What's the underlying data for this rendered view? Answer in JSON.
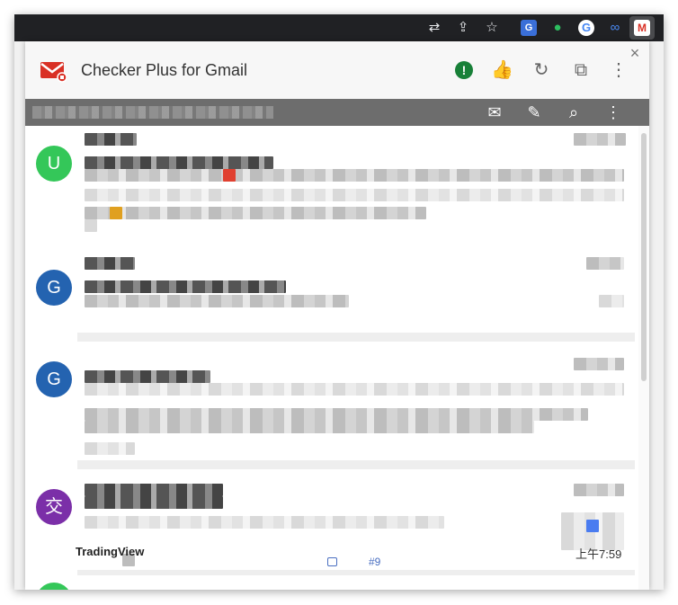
{
  "browser": {
    "icons": [
      "translate-icon",
      "share-icon",
      "star-icon",
      "google-translate-ext-icon",
      "evernote-ext-icon",
      "google-ext-icon",
      "link-ext-icon",
      "gmail-checker-ext-icon"
    ]
  },
  "popup": {
    "close_label": "×",
    "title": "Checker Plus for Gmail",
    "header_icons": [
      "alert-icon",
      "thumbs-up-icon",
      "refresh-icon",
      "open-in-tab-icon",
      "more-vert-icon"
    ],
    "toolbar_icons": [
      "mark-all-read-icon",
      "compose-icon",
      "search-icon",
      "more-vert-icon"
    ]
  },
  "mails": [
    {
      "avatar_letter": "U",
      "avatar_color": "#34c759"
    },
    {
      "avatar_letter": "G",
      "avatar_color": "#2463b0"
    },
    {
      "avatar_letter": "G",
      "avatar_color": "#2463b0"
    },
    {
      "avatar_letter": "交",
      "avatar_color": "#7b2fa8"
    }
  ],
  "partial_row": {
    "sender": "TradingView",
    "time": "上午7:59",
    "tag": "#9"
  },
  "colors": {
    "browser_bar": "#202124",
    "toolbar": "#6d6d6d",
    "header": "#f7f7f7",
    "gmail_red": "#d93025"
  }
}
